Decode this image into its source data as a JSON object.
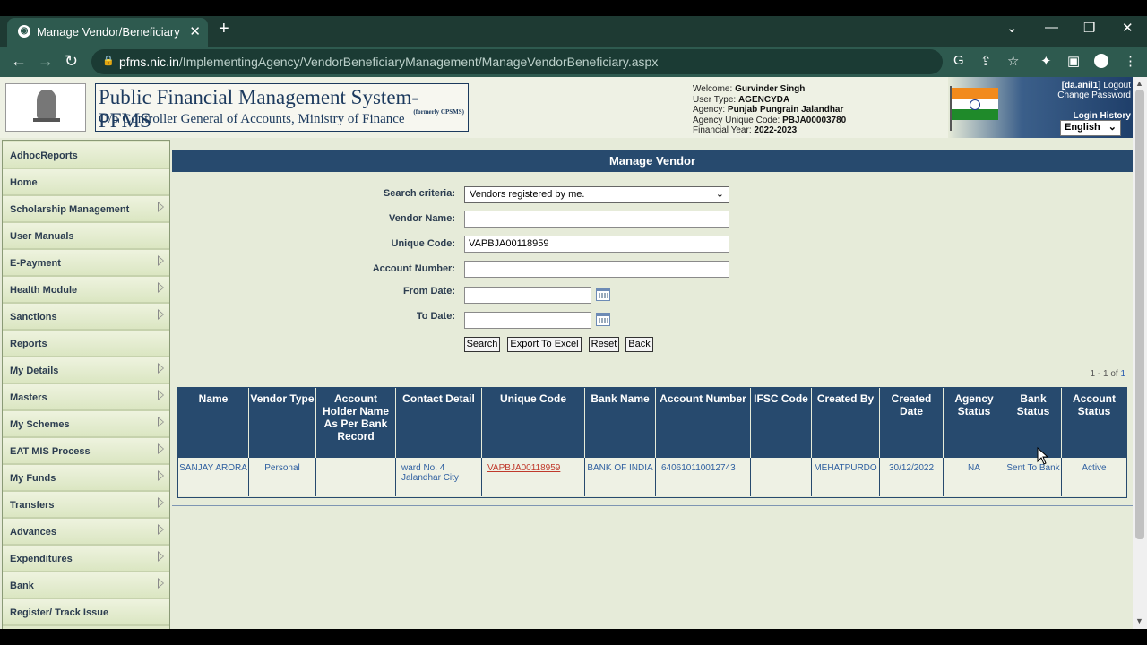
{
  "browser": {
    "tab_title": "Manage Vendor/Beneficiary",
    "tab_close": "✕",
    "new_tab": "+",
    "url_host": "pfms.nic.in",
    "url_path": "/ImplementingAgency/VendorBeneficiaryManagement/ManageVendorBeneficiary.aspx",
    "window_controls": {
      "dropdown": "⌄",
      "minimize": "—",
      "restore": "❐",
      "close": "✕"
    },
    "nav": {
      "back": "←",
      "forward": "→",
      "reload": "↻"
    },
    "right_icons": {
      "google": "G",
      "share": "⇪",
      "star": "☆",
      "extensions": "✦",
      "sidepanel": "▣",
      "menu": "⋮"
    }
  },
  "header": {
    "title": "Public Financial Management System-PFMS",
    "subtitle": "O/o Controller General of Accounts, Ministry of Finance",
    "formerly": "(formerly CPSMS)",
    "info_lines": [
      {
        "label": "Welcome: ",
        "value": "Gurvinder Singh"
      },
      {
        "label": "User Type: ",
        "value": "AGENCYDA"
      },
      {
        "label": "Agency: ",
        "value": "Punjab Pungrain Jalandhar"
      },
      {
        "label": "Agency Unique Code: ",
        "value": "PBJA00003780"
      },
      {
        "label": "Financial Year: ",
        "value": "2022-2023"
      }
    ],
    "user_link": "[da.anil1]",
    "logout": "Logout",
    "change_password": "Change Password",
    "login_history": "Login History",
    "language": "English"
  },
  "sidebar": {
    "items": [
      {
        "label": "AdhocReports",
        "arrow": false
      },
      {
        "label": "Home",
        "arrow": false
      },
      {
        "label": "Scholarship Management",
        "arrow": true
      },
      {
        "label": "User Manuals",
        "arrow": false
      },
      {
        "label": "E-Payment",
        "arrow": true
      },
      {
        "label": "Health Module",
        "arrow": true
      },
      {
        "label": "Sanctions",
        "arrow": true
      },
      {
        "label": "Reports",
        "arrow": false
      },
      {
        "label": "My Details",
        "arrow": true
      },
      {
        "label": "Masters",
        "arrow": true
      },
      {
        "label": "My Schemes",
        "arrow": true
      },
      {
        "label": "EAT MIS Process",
        "arrow": true
      },
      {
        "label": "My Funds",
        "arrow": true
      },
      {
        "label": "Transfers",
        "arrow": true
      },
      {
        "label": "Advances",
        "arrow": true
      },
      {
        "label": "Expenditures",
        "arrow": true
      },
      {
        "label": "Bank",
        "arrow": true
      },
      {
        "label": "Register/ Track Issue",
        "arrow": false
      }
    ]
  },
  "main": {
    "heading": "Manage Vendor",
    "form": {
      "search_criteria_label": "Search criteria:",
      "search_criteria_value": "Vendors registered by me.",
      "vendor_name_label": "Vendor Name:",
      "vendor_name_value": "",
      "unique_code_label": "Unique Code:",
      "unique_code_value": "VAPBJA00118959",
      "account_number_label": "Account Number:",
      "account_number_value": "",
      "from_date_label": "From Date:",
      "from_date_value": "",
      "to_date_label": "To Date:",
      "to_date_value": ""
    },
    "buttons": {
      "search": "Search",
      "export": "Export To Excel",
      "reset": "Reset",
      "back": "Back"
    },
    "pager": {
      "prefix": "1 - 1 of ",
      "total": "1"
    },
    "table": {
      "headers": [
        "Name",
        "Vendor Type",
        "Account Holder Name As Per Bank Record",
        "Contact Detail",
        "Unique Code",
        "Bank Name",
        "Account Number",
        "IFSC Code",
        "Created By",
        "Created Date",
        "Agency Status",
        "Bank Status",
        "Account Status"
      ],
      "rows": [
        [
          "SANJAY ARORA",
          "Personal",
          "",
          "ward No. 4 Jalandhar City",
          "VAPBJA00118959",
          "BANK OF INDIA",
          "640610110012743",
          "",
          "MEHATPURDO",
          "30/12/2022",
          "NA",
          "Sent To Bank",
          "Active"
        ]
      ]
    }
  }
}
